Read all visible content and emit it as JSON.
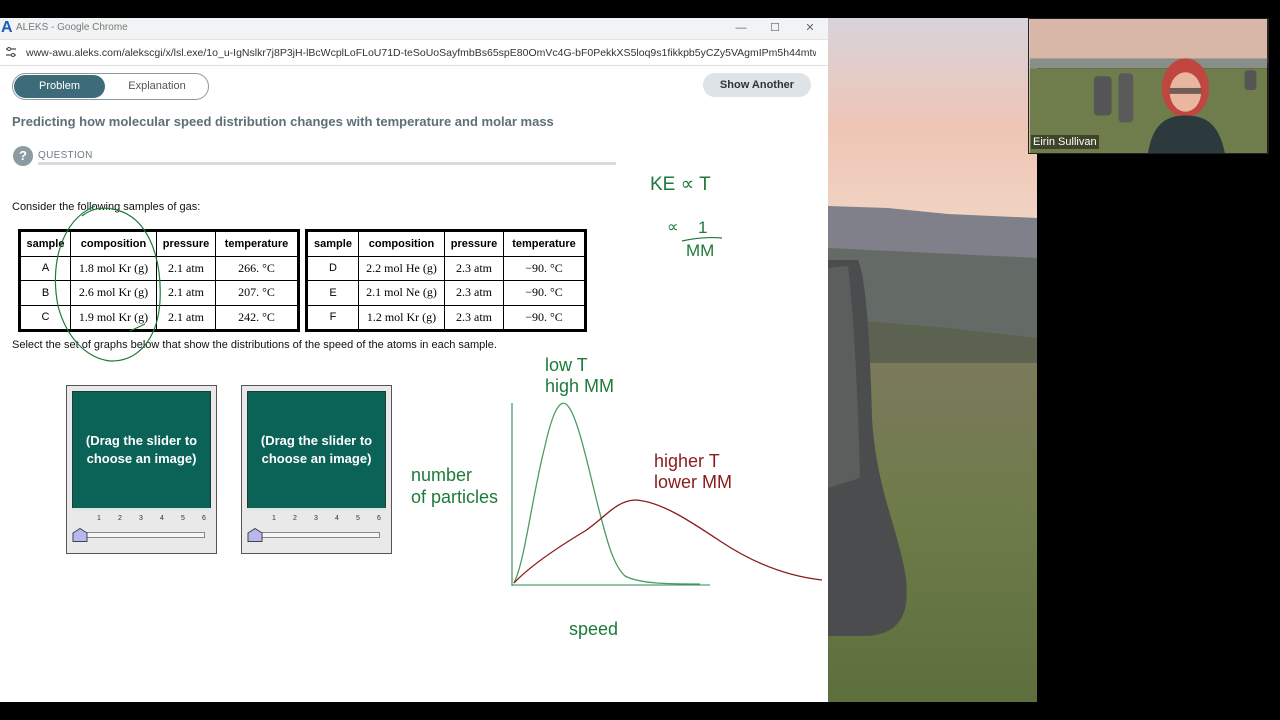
{
  "window": {
    "logo": "A",
    "title": "ALEKS - Google Chrome",
    "url": "www-awu.aleks.com/alekscgi/x/lsl.exe/1o_u-IgNslkr7j8P3jH-lBcWcplLoFLoU71D-teSoUoSayfmbBs65spE80OmVc4G-bF0PekkXS5loq9s1fikkpb5yCZy5VAgmIPm5h44mtw..."
  },
  "tabs": {
    "problem": "Problem",
    "explanation": "Explanation"
  },
  "show_another_label": "Show Another",
  "problem_title": "Predicting how molecular speed distribution changes with temperature and molar mass",
  "question": {
    "icon": "?",
    "label": "QUESTION"
  },
  "consider_text": "Consider the following samples of gas:",
  "table_headers": [
    "sample",
    "composition",
    "pressure",
    "temperature"
  ],
  "table_left_rows": [
    [
      "A",
      "1.8 mol Kr (g)",
      "2.1 atm",
      "266. °C"
    ],
    [
      "B",
      "2.6 mol Kr (g)",
      "2.1 atm",
      "207. °C"
    ],
    [
      "C",
      "1.9 mol Kr (g)",
      "2.1 atm",
      "242. °C"
    ]
  ],
  "table_right_rows": [
    [
      "D",
      "2.2 mol He (g)",
      "2.3 atm",
      "−90. °C"
    ],
    [
      "E",
      "2.1 mol Ne (g)",
      "2.3 atm",
      "−90. °C"
    ],
    [
      "F",
      "1.2 mol Kr (g)",
      "2.3 atm",
      "−90. °C"
    ]
  ],
  "select_text": "Select the set of graphs below that show the distributions of the speed of the atoms in each sample.",
  "graph_panels": [
    {
      "placeholder": "(Drag the slider to choose an image)",
      "ticks": [
        "1",
        "2",
        "3",
        "4",
        "5",
        "6"
      ],
      "slider_value": 0
    },
    {
      "placeholder": "(Drag the slider to choose an image)",
      "ticks": [
        "1",
        "2",
        "3",
        "4",
        "5",
        "6"
      ],
      "slider_value": 0
    }
  ],
  "annotations": {
    "ke_relation": "KE ∝ T",
    "mm_numerator": "1",
    "mm_denominator": "MM",
    "proportional": "∝",
    "low_t": "low T",
    "high_mm": "high MM",
    "higher_t": "higher T",
    "lower_mm": "lower MM",
    "ylabel_1": "number",
    "ylabel_2": "of particles",
    "xlabel": "speed"
  },
  "colors": {
    "ink_green": "#1d7a3a",
    "ink_red": "#8b1a1a",
    "tab_active": "#3d6b7a",
    "panel_screen": "#0b6358"
  },
  "webcam": {
    "name": "Eirin Sullivan"
  }
}
